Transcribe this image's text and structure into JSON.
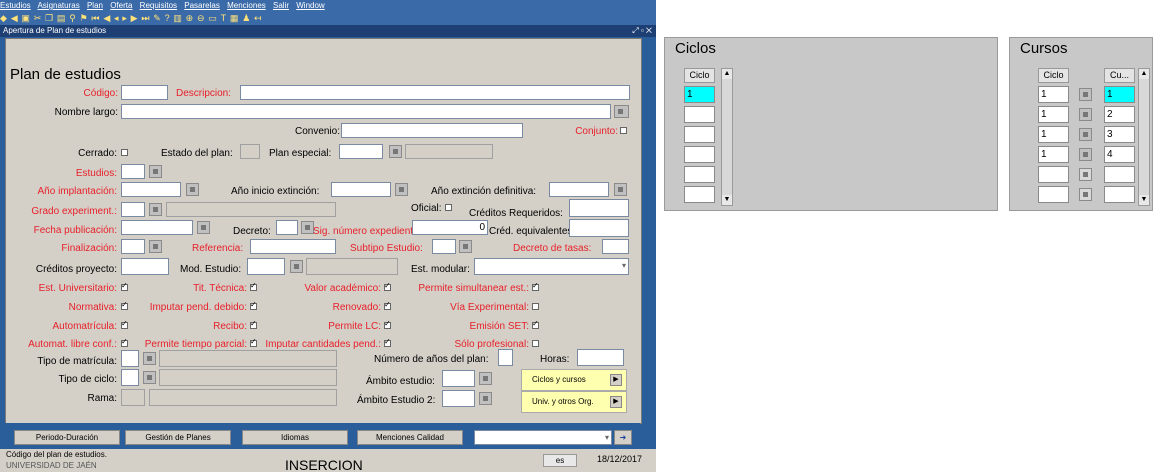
{
  "menu": [
    "Estudios",
    "Asignaturas",
    "Plan",
    "Oferta",
    "Requisitos",
    "Pasarelas",
    "Menciones",
    "Salir",
    "Window"
  ],
  "window_title": "Apertura de Plan de estudios",
  "form": {
    "title": "Plan de estudios",
    "codigo_label": "Código:",
    "descripcion_label": "Descripcion:",
    "nombre_largo_label": "Nombre largo:",
    "convenio_label": "Convenio:",
    "conjunto_label": "Conjunto:",
    "cerrado_label": "Cerrado:",
    "estado_plan_label": "Estado del plan:",
    "plan_especial_label": "Plan especial:",
    "estudios_label": "Estudios:",
    "anio_implantacion_label": "Año implantación:",
    "anio_inicio_extincion_label": "Año inicio extinción:",
    "anio_extincion_def_label": "Año extinción definitiva:",
    "grado_experiment_label": "Grado experiment.:",
    "oficial_label": "Oficial:",
    "creditos_requeridos_label": "Créditos Requeridos:",
    "fecha_publicacion_label": "Fecha publicación:",
    "decreto_label": "Decreto:",
    "sig_numero_label": "Sig. número expediente:",
    "sig_numero_value": "0",
    "cred_equivalentes_label": "Créd. equivalentes:",
    "finalizacion_label": "Finalización:",
    "referencia_label": "Referencia:",
    "subtipo_label": "Subtipo Estudio:",
    "decreto_tasas_label": "Decreto de tasas:",
    "creditos_proyecto_label": "Créditos proyecto:",
    "mod_estudio_label": "Mod. Estudio:",
    "est_modular_label": "Est. modular:",
    "est_universitario_label": "Est. Universitario:",
    "tit_tecnica_label": "Tit. Técnica:",
    "valor_academico_label": "Valor académico:",
    "permite_simultanear_label": "Permite simultanear est.:",
    "normativa_label": "Normativa:",
    "imputar_pend_label": "Imputar pend. debido:",
    "renovado_label": "Renovado:",
    "via_experimental_label": "Vía Experimental:",
    "automatricula_label": "Automatrícula:",
    "recibo_label": "Recibo:",
    "permite_lc_label": "Permite LC:",
    "emision_set_label": "Emisión SET:",
    "automat_libre_label": "Automat. libre conf.:",
    "permite_tiempo_label": "Permite tiempo parcial:",
    "imputar_cantidades_label": "Imputar cantidades pend.:",
    "solo_profesional_label": "Sólo profesional:",
    "tipo_matricula_label": "Tipo de matrícula:",
    "num_anios_label": "Número de años del plan:",
    "horas_label": "Horas:",
    "tipo_ciclo_label": "Tipo de ciclo:",
    "ambito_estudio_label": "Ámbito estudio:",
    "rama_label": "Rama:",
    "ambito_estudio2_label": "Ámbito Estudio 2:",
    "ciclos_cursos_btn": "Ciclos y cursos",
    "univ_otros_btn": "Univ. y otros Org."
  },
  "bottom_buttons": [
    "Periodo-Duración",
    "Gestión de Planes",
    "Idiomas",
    "Menciones Calidad"
  ],
  "status": {
    "hint": "Código del plan de estudios.",
    "sub": "UNIVERSIDAD DE JAÉN",
    "mode": "INSERCION",
    "lang": "es",
    "date": "18/12/2017"
  },
  "ciclos_panel": {
    "title": "Ciclos",
    "col_header": "Ciclo",
    "rows": [
      "1",
      "",
      "",
      "",
      "",
      ""
    ]
  },
  "cursos_panel": {
    "title": "Cursos",
    "col1_header": "Ciclo",
    "col2_header": "Cu...",
    "rows": [
      {
        "ciclo": "1",
        "curso": "1"
      },
      {
        "ciclo": "1",
        "curso": "2"
      },
      {
        "ciclo": "1",
        "curso": "3"
      },
      {
        "ciclo": "1",
        "curso": "4"
      },
      {
        "ciclo": "",
        "curso": ""
      },
      {
        "ciclo": "",
        "curso": ""
      }
    ]
  },
  "colors": {
    "title_bar": "#1e3f73",
    "form_bg": "#d4d0c8",
    "required_label": "#e8202a",
    "selected_cell": "#00ffff"
  }
}
